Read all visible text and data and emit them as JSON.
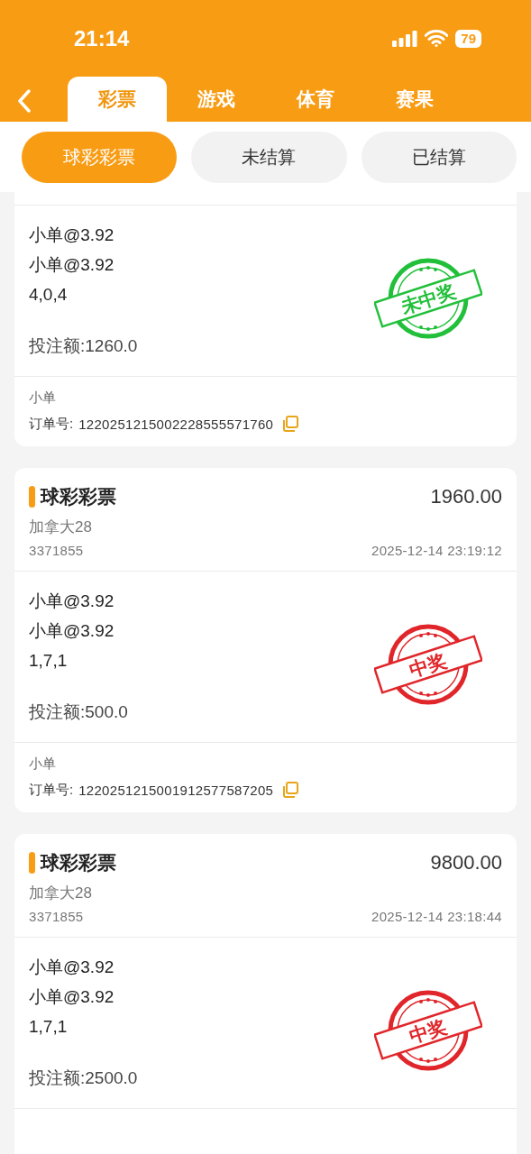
{
  "status_bar": {
    "time": "21:14",
    "battery": "79"
  },
  "tabs": [
    {
      "label": "彩票",
      "selected": true
    },
    {
      "label": "游戏",
      "selected": false
    },
    {
      "label": "体育",
      "selected": false
    },
    {
      "label": "赛果",
      "selected": false
    }
  ],
  "filters": [
    {
      "label": "球彩彩票",
      "selected": true
    },
    {
      "label": "未结算",
      "selected": false
    },
    {
      "label": "已结算",
      "selected": false
    }
  ],
  "orders": [
    {
      "lines": [
        "小单@3.92",
        "小单@3.92",
        "4,0,4"
      ],
      "stake": "投注额:1260.0",
      "stamp": {
        "text": "未中奖",
        "color": "#22c03a"
      },
      "footer": {
        "type": "小单",
        "order_label": "订单号:",
        "order_no": "1220251215002228555571760"
      }
    },
    {
      "header": {
        "title": "球彩彩票",
        "amount": "1960.00",
        "game": "加拿大28",
        "issue": "3371855",
        "time": "2025-12-14 23:19:12"
      },
      "lines": [
        "小单@3.92",
        "小单@3.92",
        "1,7,1"
      ],
      "stake": "投注额:500.0",
      "stamp": {
        "text": "中奖",
        "color": "#e0262a"
      },
      "footer": {
        "type": "小单",
        "order_label": "订单号:",
        "order_no": "1220251215001912577587205"
      }
    },
    {
      "header": {
        "title": "球彩彩票",
        "amount": "9800.00",
        "game": "加拿大28",
        "issue": "3371855",
        "time": "2025-12-14 23:18:44"
      },
      "lines": [
        "小单@3.92",
        "小单@3.92",
        "1,7,1"
      ],
      "stake": "投注额:2500.0",
      "stamp": {
        "text": "中奖",
        "color": "#e0262a"
      }
    }
  ]
}
